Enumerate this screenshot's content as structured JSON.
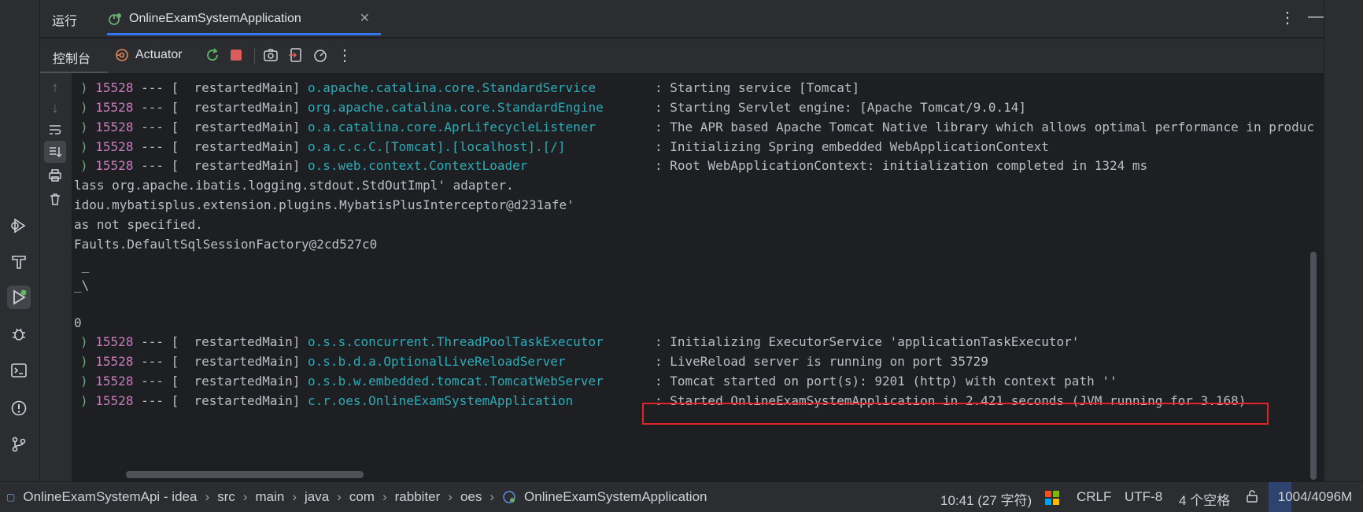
{
  "run_tab": {
    "title": "运行",
    "app_tab": "OnlineExamSystemApplication"
  },
  "toolbar": {
    "console_tab": "控制台",
    "actuator_tab": "Actuator"
  },
  "console_lines": [
    {
      "pid": "15528",
      "sep": "---",
      "thread": "restartedMain",
      "logger": "o.apache.catalina.core.StandardService",
      "msg": "Starting service [Tomcat]"
    },
    {
      "pid": "15528",
      "sep": "---",
      "thread": "restartedMain",
      "logger": "org.apache.catalina.core.StandardEngine",
      "msg": "Starting Servlet engine: [Apache Tomcat/9.0.14]"
    },
    {
      "pid": "15528",
      "sep": "---",
      "thread": "restartedMain",
      "logger": "o.a.catalina.core.AprLifecycleListener",
      "msg": "The APR based Apache Tomcat Native library which allows optimal performance in produc"
    },
    {
      "pid": "15528",
      "sep": "---",
      "thread": "restartedMain",
      "logger": "o.a.c.c.C.[Tomcat].[localhost].[/]",
      "msg": "Initializing Spring embedded WebApplicationContext"
    },
    {
      "pid": "15528",
      "sep": "---",
      "thread": "restartedMain",
      "logger": "o.s.web.context.ContextLoader",
      "msg": "Root WebApplicationContext: initialization completed in 1324 ms"
    }
  ],
  "plain_lines": [
    "lass org.apache.ibatis.logging.stdout.StdOutImpl' adapter.",
    "idou.mybatisplus.extension.plugins.MybatisPlusInterceptor@d231afe'",
    "as not specified.",
    "Faults.DefaultSqlSessionFactory@2cd527c0",
    " _",
    "_\\",
    "",
    "0"
  ],
  "console_lines2": [
    {
      "pid": "15528",
      "sep": "---",
      "thread": "restartedMain",
      "logger": "o.s.s.concurrent.ThreadPoolTaskExecutor",
      "msg": "Initializing ExecutorService 'applicationTaskExecutor'"
    },
    {
      "pid": "15528",
      "sep": "---",
      "thread": "restartedMain",
      "logger": "o.s.b.d.a.OptionalLiveReloadServer",
      "msg": "LiveReload server is running on port 35729"
    },
    {
      "pid": "15528",
      "sep": "---",
      "thread": "restartedMain",
      "logger": "o.s.b.w.embedded.tomcat.TomcatWebServer",
      "msg": "Tomcat started on port(s): 9201 (http) with context path ''"
    },
    {
      "pid": "15528",
      "sep": "---",
      "thread": "restartedMain",
      "logger": "c.r.oes.OnlineExamSystemApplication",
      "msg": "Started OnlineExamSystemApplication in 2.421 seconds (JVM running for 3.168)"
    }
  ],
  "breadcrumb": [
    "OnlineExamSystemApi - idea",
    "src",
    "main",
    "java",
    "com",
    "rabbiter",
    "oes",
    "OnlineExamSystemApplication"
  ],
  "status": {
    "position": "10:41 (27 字符)",
    "line_sep": "CRLF",
    "encoding": "UTF-8",
    "indent": "4 个空格",
    "memory": "1004/4096M",
    "memory_fraction": 0.245
  },
  "colors": {
    "accent": "#3574f0",
    "pid": "#c77dbb",
    "logger": "#2aacb8",
    "highlight_border": "#e0252a"
  }
}
